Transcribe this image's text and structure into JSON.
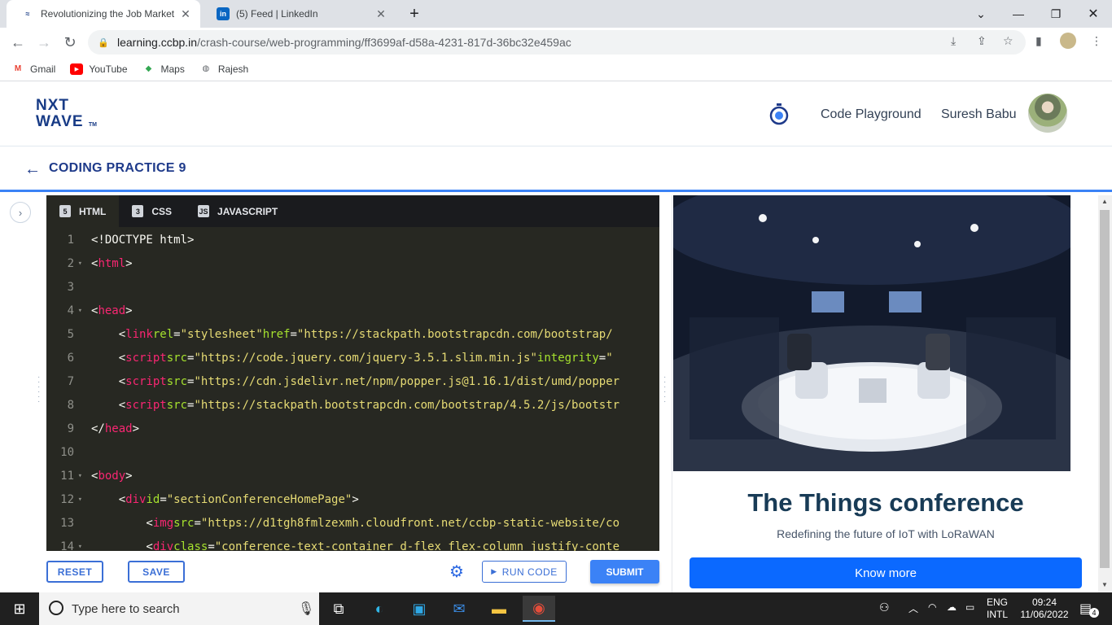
{
  "browser": {
    "tabs": [
      {
        "title": "Revolutionizing the Job Market |",
        "active": true
      },
      {
        "title": "(5) Feed | LinkedIn",
        "active": false
      }
    ],
    "url_host": "learning.ccbp.in",
    "url_path": "/crash-course/web-programming/ff3699af-d58a-4231-817d-36bc32e459ac",
    "bookmarks": [
      "Gmail",
      "YouTube",
      "Maps",
      "Rajesh"
    ]
  },
  "header": {
    "logo_line1": "NXT",
    "logo_line2": "WAVE",
    "logo_tm": "TM",
    "code_playground": "Code Playground",
    "user_name": "Suresh Babu"
  },
  "subheader": {
    "title": "CODING PRACTICE 9"
  },
  "editor": {
    "tabs": [
      {
        "label": "HTML",
        "icon": "html5-icon"
      },
      {
        "label": "CSS",
        "icon": "css3-icon"
      },
      {
        "label": "JAVASCRIPT",
        "icon": "javascript-icon"
      }
    ],
    "lines": [
      {
        "n": "1",
        "fold": false
      },
      {
        "n": "2",
        "fold": true
      },
      {
        "n": "3",
        "fold": false
      },
      {
        "n": "4",
        "fold": true
      },
      {
        "n": "5",
        "fold": false
      },
      {
        "n": "6",
        "fold": false
      },
      {
        "n": "7",
        "fold": false
      },
      {
        "n": "8",
        "fold": false
      },
      {
        "n": "9",
        "fold": false
      },
      {
        "n": "10",
        "fold": false
      },
      {
        "n": "11",
        "fold": true
      },
      {
        "n": "12",
        "fold": true
      },
      {
        "n": "13",
        "fold": false
      },
      {
        "n": "14",
        "fold": true
      }
    ],
    "code": {
      "l1": "<!DOCTYPE html>",
      "l2_open": "<",
      "l2_tag": "html",
      "l2_close": ">",
      "l4_tag": "head",
      "l5_tag": "link",
      "l5_a1": "rel",
      "l5_v1": "\"stylesheet\"",
      "l5_a2": "href",
      "l5_v2": "\"https://stackpath.bootstrapcdn.com/bootstrap/",
      "l6_tag": "script",
      "l6_a1": "src",
      "l6_v1": "\"https://code.jquery.com/jquery-3.5.1.slim.min.js\"",
      "l6_a2": "integrity",
      "l6_v2": "\"",
      "l7_tag": "script",
      "l7_a1": "src",
      "l7_v1": "\"https://cdn.jsdelivr.net/npm/popper.js@1.16.1/dist/umd/popper",
      "l8_tag": "script",
      "l8_a1": "src",
      "l8_v1": "\"https://stackpath.bootstrapcdn.com/bootstrap/4.5.2/js/bootstr",
      "l9_tag": "head",
      "l11_tag": "body",
      "l12_tag": "div",
      "l12_a1": "id",
      "l12_v1": "\"sectionConferenceHomePage\"",
      "l13_tag": "img",
      "l13_a1": "src",
      "l13_v1": "\"https://d1tgh8fmlzexmh.cloudfront.net/ccbp-static-website/co",
      "l14_tag": "div",
      "l14_a1": "class",
      "l14_v1": "\"conference-text-container d-flex flex-column justify-conte"
    }
  },
  "controls": {
    "reset": "RESET",
    "save": "SAVE",
    "run": "RUN CODE",
    "submit": "SUBMIT"
  },
  "preview": {
    "title": "The Things conference",
    "subtitle": "Redefining the future of IoT with LoRaWAN",
    "button": "Know more"
  },
  "taskbar": {
    "search_placeholder": "Type here to search",
    "lang_line1": "ENG",
    "lang_line2": "INTL",
    "time": "09:24",
    "date": "11/06/2022",
    "notifications": "4"
  },
  "colors": {
    "brand": "#183b86",
    "accent": "#3b82f6",
    "editor_bg": "#272822",
    "preview_title": "#183b56",
    "cta": "#0b69ff"
  }
}
